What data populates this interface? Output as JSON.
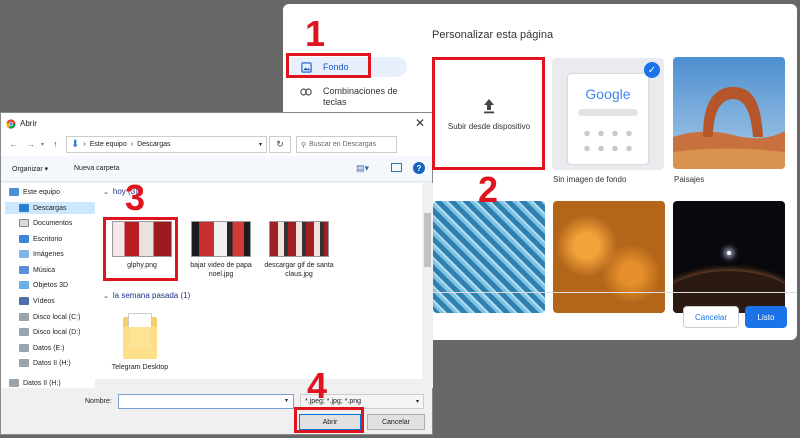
{
  "chrome": {
    "title": "Personalizar esta página",
    "sidebar": [
      {
        "label": "Fondo",
        "icon": "image-icon",
        "selected": true
      },
      {
        "label": "Combinaciones de teclas",
        "icon": "link-icon",
        "selected": false
      }
    ],
    "upload_label": "Subir desde dispositivo",
    "tiles": [
      {
        "caption": "Sin imagen de fondo",
        "selected": true
      },
      {
        "caption": "Paisajes"
      }
    ],
    "google_logo": "Google",
    "buttons": {
      "cancel": "Cancelar",
      "done": "Listo"
    },
    "colors": {
      "accent": "#1a73e8",
      "selected_bg": "#e8f0fe"
    }
  },
  "dialog": {
    "title": "Abrir",
    "breadcrumb": [
      "Este equipo",
      "Descargas"
    ],
    "search_placeholder": "Buscar en Descargas",
    "toolbar": {
      "organize": "Organizar ▾",
      "new_folder": "Nueva carpeta"
    },
    "tree": [
      "Este equipo",
      "Descargas",
      "Documentos",
      "Escritorio",
      "Imágenes",
      "Música",
      "Objetos 3D",
      "Vídeos",
      "Disco local (C:)",
      "Disco local (D:)",
      "Datos (E:)",
      "Datos II (H:)",
      "Datos II (H:)"
    ],
    "groups": [
      {
        "label": "hoy (3)",
        "files": [
          "glphy.png",
          "bajar video de papa noel.jpg",
          "descargar gif de santa claus.jpg"
        ]
      },
      {
        "label": "la semana pasada (1)",
        "files": [
          "Telegram Desktop"
        ]
      }
    ],
    "filename_label": "Nombre:",
    "filename_value": "",
    "filetypes": "*.jpeg; *.jpg; *.png",
    "buttons": {
      "open": "Abrir",
      "cancel": "Cancelar"
    }
  },
  "annotations": {
    "steps": [
      "1",
      "2",
      "3",
      "4"
    ],
    "color": "#e0141e"
  }
}
